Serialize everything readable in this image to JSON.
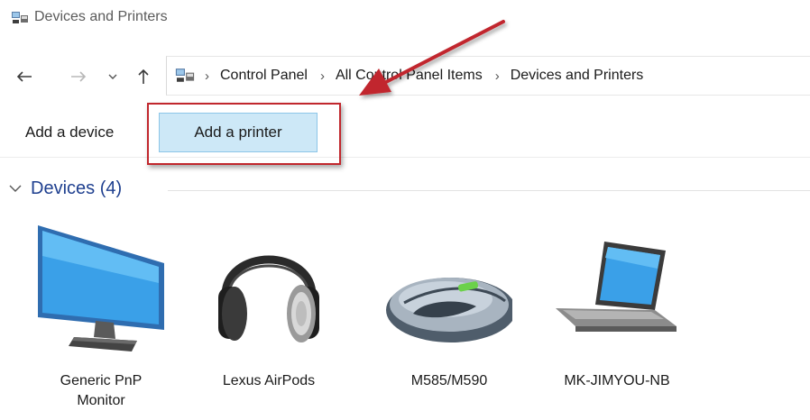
{
  "window": {
    "title": "Devices and Printers",
    "title_icon": "devices-printers-icon"
  },
  "address_bar": {
    "back_icon": "arrow-left-icon",
    "forward_icon": "arrow-right-icon",
    "recent_icon": "chevron-down-icon",
    "up_icon": "arrow-up-icon",
    "location_icon": "devices-printers-icon",
    "separator": "›",
    "breadcrumbs": [
      "Control Panel",
      "All Control Panel Items",
      "Devices and Printers"
    ]
  },
  "command_bar": {
    "add_device_label": "Add a device",
    "add_printer_label": "Add a printer"
  },
  "annotation": {
    "highlight_color": "#c1272d",
    "arrow_color": "#c1272d"
  },
  "group": {
    "title": "Devices (4)",
    "chevron_icon": "chevron-down-icon"
  },
  "devices": [
    {
      "label": "Generic PnP Monitor",
      "icon": "monitor-icon"
    },
    {
      "label": "Lexus AirPods",
      "icon": "headphones-icon"
    },
    {
      "label": "M585/M590",
      "icon": "mouse-icon"
    },
    {
      "label": "MK-JIMYOU-NB",
      "icon": "laptop-icon"
    }
  ]
}
